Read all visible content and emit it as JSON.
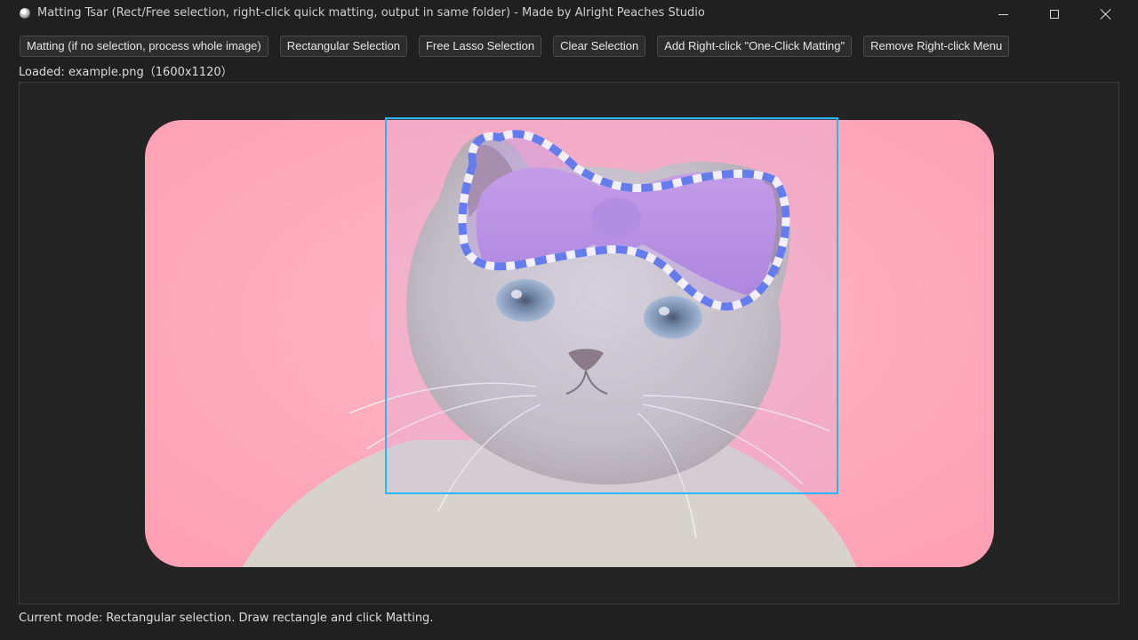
{
  "window": {
    "title": "Matting Tsar (Rect/Free selection, right-click quick matting, output in same folder) - Made by Alright Peaches Studio",
    "app_icon": "app-icon"
  },
  "toolbar": {
    "matting_label": "Matting (if no selection, process whole image)",
    "rect_selection_label": "Rectangular Selection",
    "lasso_selection_label": "Free Lasso Selection",
    "clear_selection_label": "Clear Selection",
    "add_menu_label": "Add Right-click \"One-Click Matting\"",
    "remove_menu_label": "Remove Right-click Menu"
  },
  "image_info": {
    "loaded_text": "Loaded: example.png（1600x1120）"
  },
  "status": {
    "text": "Current mode: Rectangular selection. Draw rectangle and click Matting."
  },
  "colors": {
    "selection_rect": "#29b6f6",
    "lasso_blue": "#4a6cf0",
    "lasso_white": "#ffffff",
    "photo_background": "#ffa9bd"
  }
}
